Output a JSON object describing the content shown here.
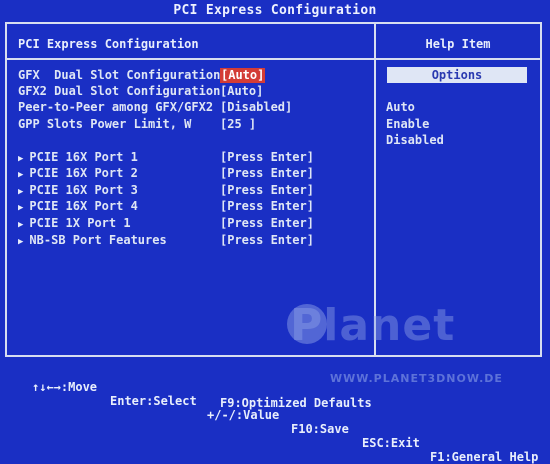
{
  "header": {
    "title": "PCI Express Configuration"
  },
  "main": {
    "section_title": "PCI Express Configuration",
    "settings": [
      {
        "label": "GFX  Dual Slot Configuration",
        "value": "[Auto]"
      },
      {
        "label": "GFX2 Dual Slot Configuration",
        "value": "[Auto]"
      },
      {
        "label": "Peer-to-Peer among GFX/GFX2",
        "value": "[Disabled]"
      },
      {
        "label": "GPP Slots Power Limit, W",
        "value": "[25 ]"
      }
    ],
    "submenus": [
      {
        "label": "PCIE 16X Port 1",
        "value": "[Press Enter]"
      },
      {
        "label": "PCIE 16X Port 2",
        "value": "[Press Enter]"
      },
      {
        "label": "PCIE 16X Port 3",
        "value": "[Press Enter]"
      },
      {
        "label": "PCIE 16X Port 4",
        "value": "[Press Enter]"
      },
      {
        "label": "PCIE 1X Port 1",
        "value": "[Press Enter]"
      },
      {
        "label": "NB-SB Port Features",
        "value": "[Press Enter]"
      }
    ]
  },
  "help": {
    "title": "Help Item",
    "options_header": "Options",
    "options": [
      "Auto",
      "Enable",
      "Disabled"
    ]
  },
  "footer": {
    "move": "↑↓←→:Move",
    "enter": "Enter:Select",
    "value": "+/-/:Value",
    "save": "F10:Save",
    "exit": "ESC:Exit",
    "help": "F1:General Help",
    "defaults": "F9:Optimized Defaults"
  },
  "watermark": {
    "brand": "Planet",
    "url": "WWW.PLANET3DNOW.DE"
  },
  "colors": {
    "background": "#1a2fc4",
    "text": "#dfe6f5",
    "highlight": "#d33c36"
  }
}
